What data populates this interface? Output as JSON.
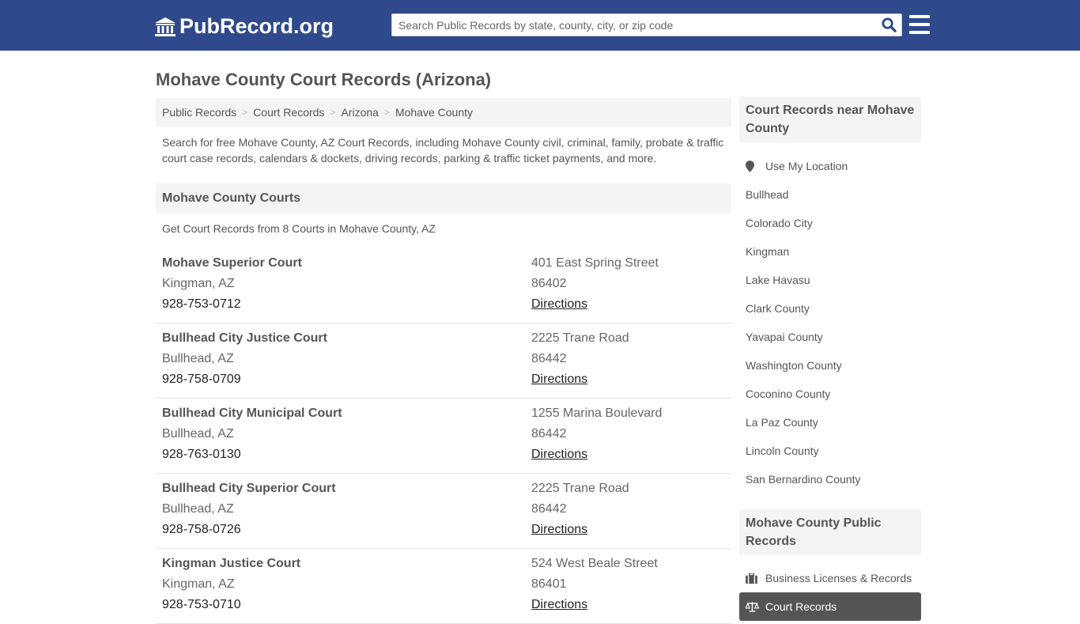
{
  "header": {
    "logo_text": "PubRecord.org",
    "search_placeholder": "Search Public Records by state, county, city, or zip code",
    "colors": {
      "bar": "#2f4a8c",
      "search_icon": "#2f4a8c"
    }
  },
  "page": {
    "title": "Mohave County Court Records (Arizona)",
    "breadcrumb": [
      "Public Records",
      "Court Records",
      "Arizona",
      "Mohave County"
    ],
    "intro": "Search for free Mohave County, AZ Court Records, including Mohave County civil, criminal, family, probate & traffic court case records, calendars & dockets, driving records, parking & traffic ticket payments, and more."
  },
  "courts_section": {
    "heading": "Mohave County Courts",
    "subline": "Get Court Records from 8 Courts in Mohave County, AZ",
    "directions_label": "Directions",
    "courts": [
      {
        "name": "Mohave Superior Court",
        "city": "Kingman, AZ",
        "phone": "928-753-0712",
        "address": "401 East Spring Street",
        "zip": "86402"
      },
      {
        "name": "Bullhead City Justice Court",
        "city": "Bullhead, AZ",
        "phone": "928-758-0709",
        "address": "2225 Trane Road",
        "zip": "86442"
      },
      {
        "name": "Bullhead City Municipal Court",
        "city": "Bullhead, AZ",
        "phone": "928-763-0130",
        "address": "1255 Marina Boulevard",
        "zip": "86442"
      },
      {
        "name": "Bullhead City Superior Court",
        "city": "Bullhead, AZ",
        "phone": "928-758-0726",
        "address": "2225 Trane Road",
        "zip": "86442"
      },
      {
        "name": "Kingman Justice Court",
        "city": "Kingman, AZ",
        "phone": "928-753-0710",
        "address": "524 West Beale Street",
        "zip": "86401"
      }
    ]
  },
  "sidebar": {
    "nearby_heading": "Court Records near Mohave County",
    "use_location": "Use My Location",
    "nearby": [
      "Bullhead",
      "Colorado City",
      "Kingman",
      "Lake Havasu",
      "Clark County",
      "Yavapai County",
      "Washington County",
      "Coconino County",
      "La Paz County",
      "Lincoln County",
      "San Bernardino County"
    ],
    "public_heading": "Mohave County Public Records",
    "public_items": [
      {
        "label": "Business Licenses & Records",
        "icon": "briefcase-icon",
        "active": false
      },
      {
        "label": "Court Records",
        "icon": "scales-icon",
        "active": true
      }
    ]
  }
}
